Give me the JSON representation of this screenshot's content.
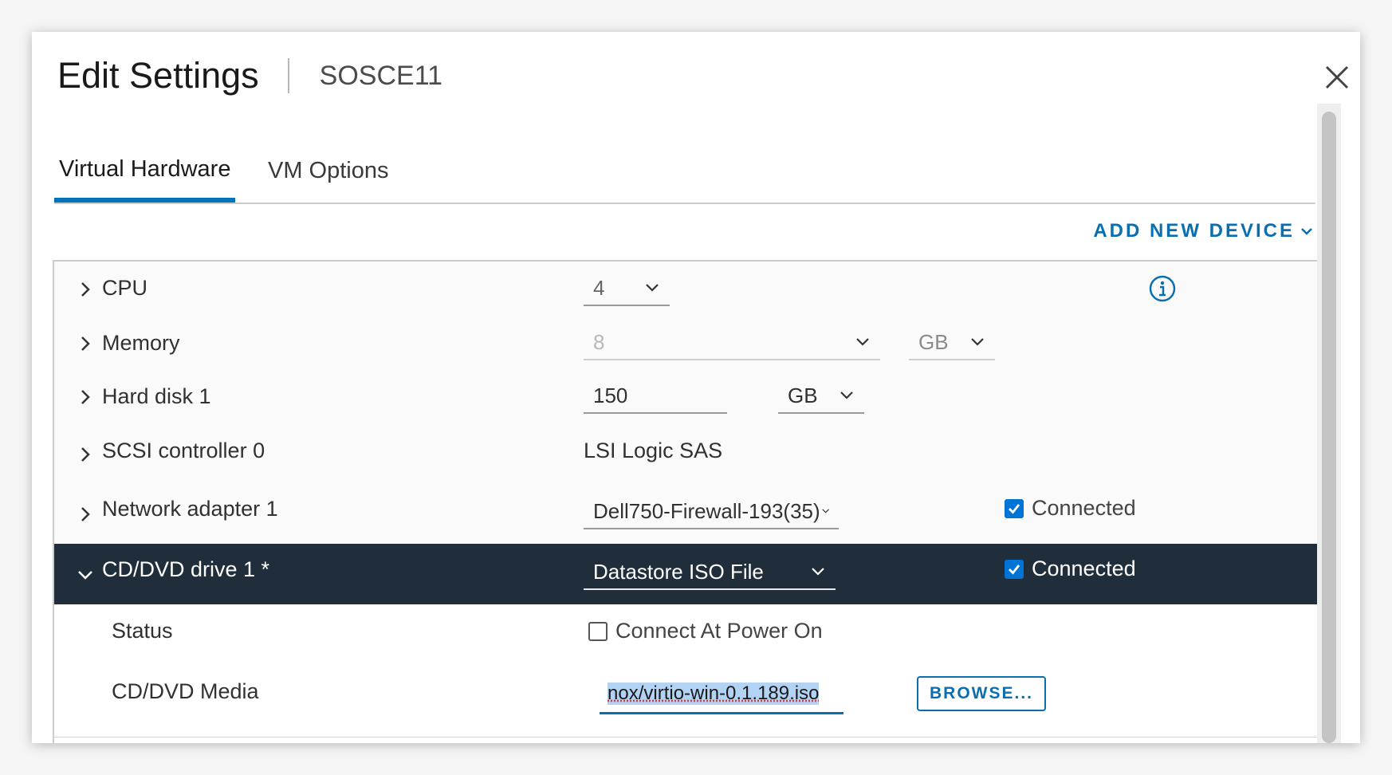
{
  "dialog": {
    "title": "Edit Settings",
    "vm_name": "SOSCE11",
    "close_icon": "close-icon"
  },
  "tabs": [
    {
      "label": "Virtual Hardware",
      "active": true
    },
    {
      "label": "VM Options",
      "active": false
    }
  ],
  "toolbar": {
    "add_device_label": "ADD NEW DEVICE"
  },
  "colors": {
    "accent": "#0073b9",
    "selected_row": "#1f2e3a",
    "checkbox": "#0073d6"
  },
  "hardware": {
    "cpu": {
      "label": "CPU",
      "value": "4"
    },
    "memory": {
      "label": "Memory",
      "value": "8",
      "unit": "GB"
    },
    "hard_disk": {
      "label": "Hard disk 1",
      "value": "150",
      "unit": "GB"
    },
    "scsi": {
      "label": "SCSI controller 0",
      "value": "LSI Logic SAS"
    },
    "network": {
      "label": "Network adapter 1",
      "value": "Dell750-Firewall-193(35)",
      "connected_label": "Connected",
      "connected": true
    },
    "cddvd": {
      "label": "CD/DVD drive 1 *",
      "value": "Datastore ISO File",
      "connected_label": "Connected",
      "connected": true,
      "status": {
        "label": "Status",
        "option_label": "Connect At Power On",
        "checked": false
      },
      "media": {
        "label": "CD/DVD Media",
        "value": "nox/virtio-win-0.1.189.iso",
        "browse_label": "BROWSE..."
      }
    }
  }
}
